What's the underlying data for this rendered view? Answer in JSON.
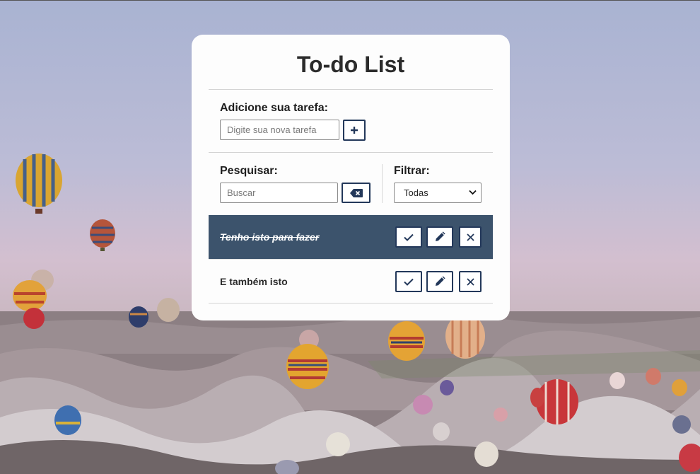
{
  "app": {
    "title": "To-do List"
  },
  "add_section": {
    "label": "Adicione sua tarefa:",
    "input_placeholder": "Digite sua nova tarefa",
    "input_value": "",
    "add_button_icon": "plus-icon"
  },
  "search_section": {
    "label": "Pesquisar:",
    "input_placeholder": "Buscar",
    "input_value": "",
    "clear_button_icon": "backspace-icon"
  },
  "filter_section": {
    "label": "Filtrar:",
    "selected": "Todas"
  },
  "tasks": [
    {
      "text": "Tenho isto para fazer",
      "done": true
    },
    {
      "text": "E também isto",
      "done": false
    }
  ],
  "task_action_icons": [
    "check-icon",
    "pencil-icon",
    "close-icon"
  ],
  "colors": {
    "accent": "#23385a",
    "done_task_bg": "#3c536c",
    "card_bg": "#fdfdfd"
  }
}
